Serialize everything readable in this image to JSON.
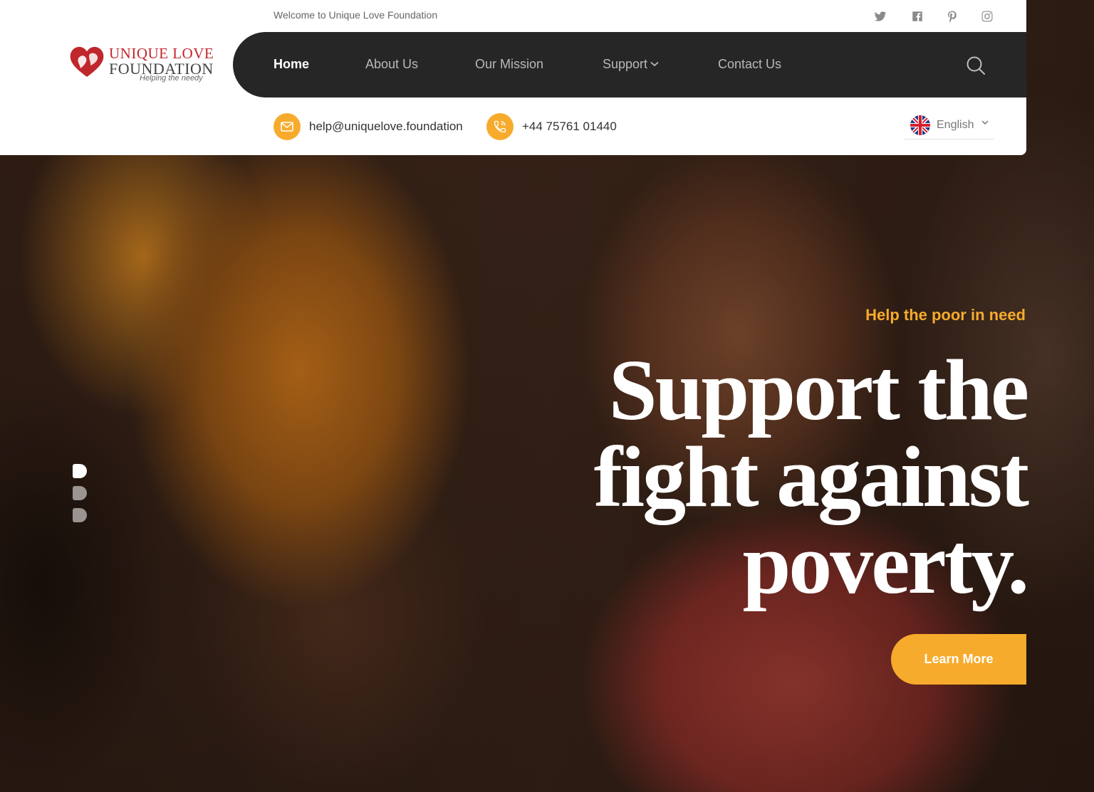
{
  "topbar": {
    "welcome": "Welcome to Unique Love Foundation",
    "social": [
      "twitter-icon",
      "facebook-icon",
      "pinterest-icon",
      "instagram-icon"
    ]
  },
  "logo": {
    "line1": "UNIQUE LOVE",
    "line2": "FOUNDATION",
    "tagline": "Helping the needy"
  },
  "nav": {
    "home": "Home",
    "about": "About Us",
    "mission": "Our Mission",
    "support": "Support",
    "contact": "Contact Us"
  },
  "contact": {
    "email": "help@uniquelove.foundation",
    "phone": "+44 75761 01440"
  },
  "language": {
    "selected": "English"
  },
  "hero": {
    "eyebrow": "Help the poor in need",
    "headline": [
      "Support the",
      "fight against",
      "poverty."
    ],
    "cta": "Learn More",
    "slides": 3,
    "active_slide": 1
  },
  "colors": {
    "accent": "#f7ab2d",
    "brand_red": "#c0272d",
    "nav_bg": "#262626"
  }
}
